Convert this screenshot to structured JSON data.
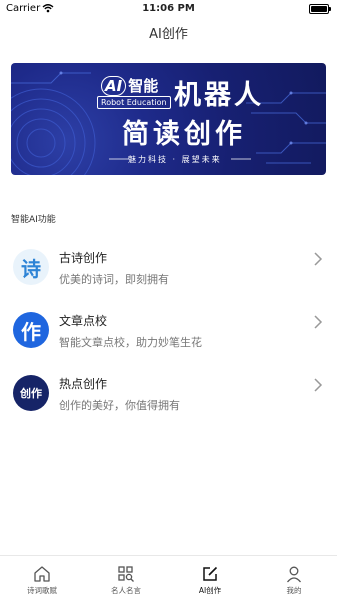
{
  "status": {
    "carrier": "Carrier",
    "time": "11:06 PM"
  },
  "nav": {
    "title": "AI创作"
  },
  "banner": {
    "ai_text": "AI",
    "ai_suffix": "智能",
    "robot_education": "Robot Education",
    "headline_1": "机器人",
    "headline_2": "简读创作",
    "slogan": "魅力科技 · 展望未来"
  },
  "section": {
    "title": "智能AI功能"
  },
  "features": [
    {
      "icon_text": "诗",
      "icon": "poem-icon",
      "title": "古诗创作",
      "subtitle": "优美的诗词，即刻拥有"
    },
    {
      "icon_text": "作",
      "icon": "proofread-icon",
      "title": "文章点校",
      "subtitle": "智能文章点校，助力妙笔生花"
    },
    {
      "icon_text": "创作",
      "icon": "hot-create-icon",
      "title": "热点创作",
      "subtitle": "创作的美好，你值得拥有"
    }
  ],
  "tabs": [
    {
      "label": "诗词歌赋",
      "icon": "home-icon",
      "active": false
    },
    {
      "label": "名人名言",
      "icon": "search-doc-icon",
      "active": false
    },
    {
      "label": "AI创作",
      "icon": "edit-icon",
      "active": true
    },
    {
      "label": "我的",
      "icon": "person-icon",
      "active": false
    }
  ]
}
